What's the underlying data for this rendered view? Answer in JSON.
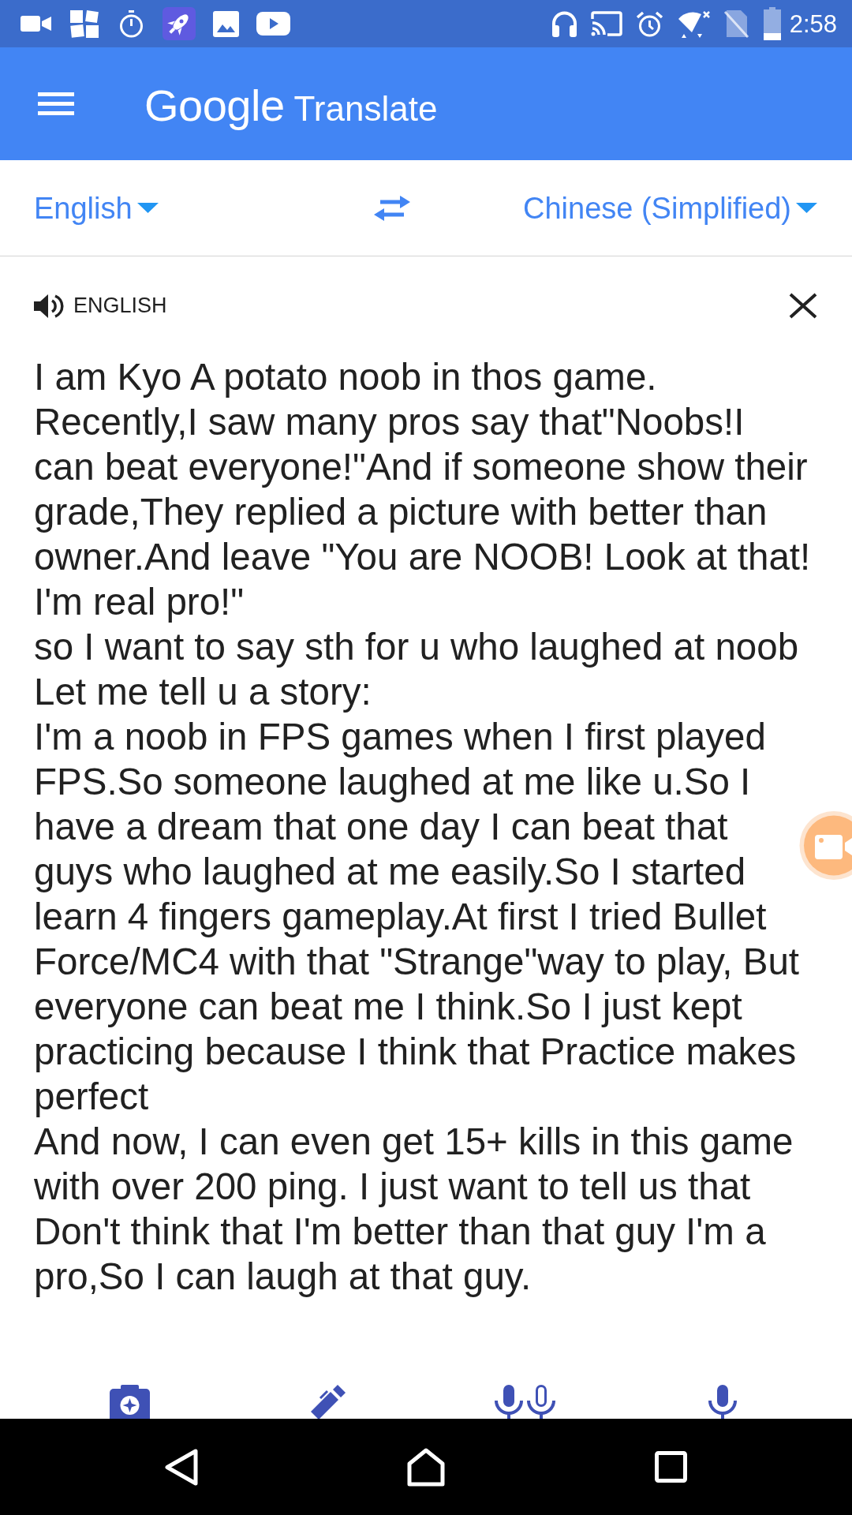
{
  "status_bar": {
    "time": "2:58"
  },
  "app_bar": {
    "logo": "Google",
    "title": "Translate"
  },
  "language_bar": {
    "source_language": "English",
    "target_language": "Chinese (Simplified)"
  },
  "input_panel": {
    "language_label": "ENGLISH",
    "text": "I am Kyo A potato noob in thos game.\nRecently,I saw many pros say that\"Noobs!I can beat everyone!\"And if someone show their grade,They replied a picture with better than owner.And leave \"You are NOOB! Look at that! I'm real pro!\"\nso I want to say sth for u who laughed at noob\nLet me tell u a story:\nI'm a noob in FPS games when I first played FPS.So someone laughed at me like u.So I have a dream that one day I can beat that guys who laughed at me easily.So I started learn 4 fingers gameplay.At first I tried Bullet Force/MC4 with that \"Strange\"way to play, But everyone can beat me I think.So I just kept practicing because I think that Practice makes perfect\nAnd now, I can even get 15+ kills in this game with over 200 ping. I just want to tell us that Don't think that I'm better than that guy I'm a pro,So I can laugh at that guy."
  }
}
